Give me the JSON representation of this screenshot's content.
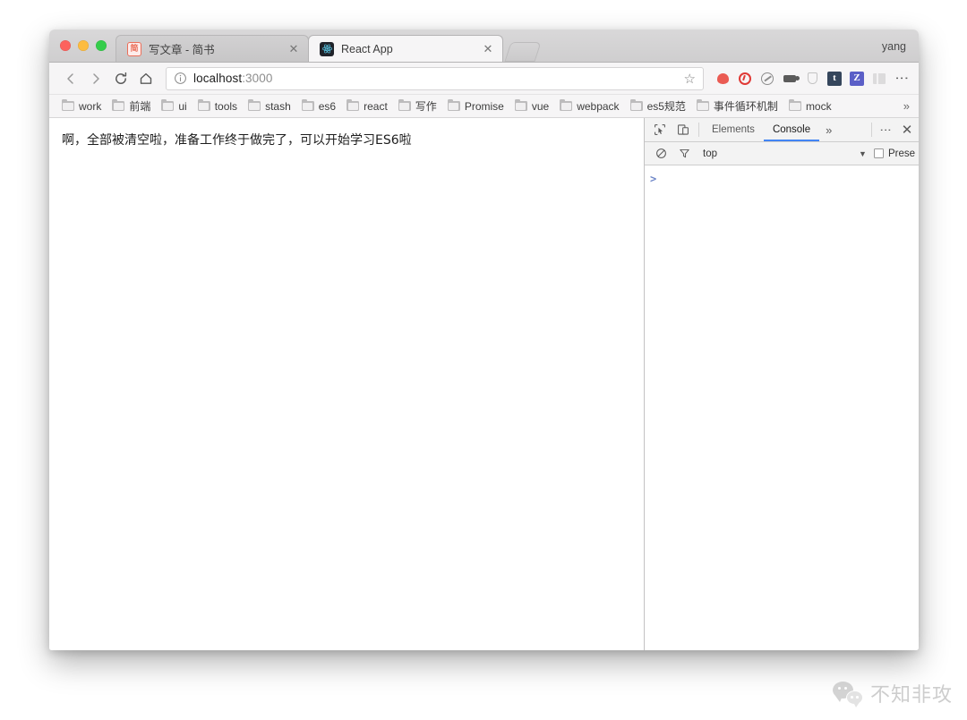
{
  "window": {
    "profile_name": "yang",
    "traffic_lights": [
      "close",
      "minimize",
      "maximize"
    ]
  },
  "tabs": [
    {
      "title": "写文章 - 简书",
      "favicon": "jianshu-favicon",
      "favicon_glyph": "简",
      "active": true,
      "closeable": true
    },
    {
      "title": "React App",
      "favicon": "react-favicon",
      "active": false,
      "closeable": true
    }
  ],
  "new_tab_label": "+",
  "toolbar": {
    "back_label": "Back",
    "forward_label": "Forward",
    "reload_label": "Reload",
    "home_label": "Home",
    "url_host": "localhost",
    "url_port": ":3000",
    "url_full": "localhost:3000",
    "security_icon": "info-circle-icon",
    "bookmark_star": "☆",
    "menu_icon": "⋮",
    "extensions": [
      {
        "name": "red-blob-extension-icon",
        "kind": "blob",
        "color": "#e8453c"
      },
      {
        "name": "opera-o-extension-icon",
        "kind": "o",
        "color": "#e03a36"
      },
      {
        "name": "circle-slash-extension-icon",
        "kind": "circ",
        "color": "#8d8d8d"
      },
      {
        "name": "camera-extension-icon",
        "kind": "cam",
        "color": "#5b5b5b"
      },
      {
        "name": "shield-extension-icon",
        "kind": "shield",
        "color": "#c3c3c3"
      },
      {
        "name": "tumblr-extension-icon",
        "kind": "square",
        "label": "t",
        "color": "#35465c"
      },
      {
        "name": "zotero-extension-icon",
        "kind": "square",
        "label": "Z",
        "color": "#5b5fc7"
      },
      {
        "name": "bars-extension-icon",
        "kind": "bars",
        "color": "#dcdbdc"
      }
    ]
  },
  "bookmarks": {
    "items": [
      {
        "label": "work"
      },
      {
        "label": "前端"
      },
      {
        "label": "ui"
      },
      {
        "label": "tools"
      },
      {
        "label": "stash"
      },
      {
        "label": "es6"
      },
      {
        "label": "react"
      },
      {
        "label": "写作"
      },
      {
        "label": "Promise"
      },
      {
        "label": "vue"
      },
      {
        "label": "webpack"
      },
      {
        "label": "es5规范"
      },
      {
        "label": "事件循环机制"
      },
      {
        "label": "mock"
      }
    ],
    "overflow_label": "»"
  },
  "page": {
    "body_text": "啊，全部被清空啦，准备工作终于做完了，可以开始学习ES6啦"
  },
  "devtools": {
    "inspect_icon": "inspect-element-icon",
    "device_icon": "device-toolbar-icon",
    "tabs": [
      {
        "label": "Elements",
        "active": false
      },
      {
        "label": "Console",
        "active": true
      }
    ],
    "more_tabs_label": "»",
    "menu_icon": "⋮",
    "close_icon": "✕",
    "filter_bar": {
      "clear_icon": "clear-console-icon",
      "filter_icon": "filter-funnel-icon",
      "context": "top",
      "caret": "▼",
      "preserve_log_label": "Prese",
      "preserve_log_checked": false
    },
    "console": {
      "prompt": "❯",
      "entries": []
    },
    "accent_color": "#4285f4"
  },
  "watermark": {
    "text": "不知非攻",
    "icon": "wechat-logo-icon"
  }
}
